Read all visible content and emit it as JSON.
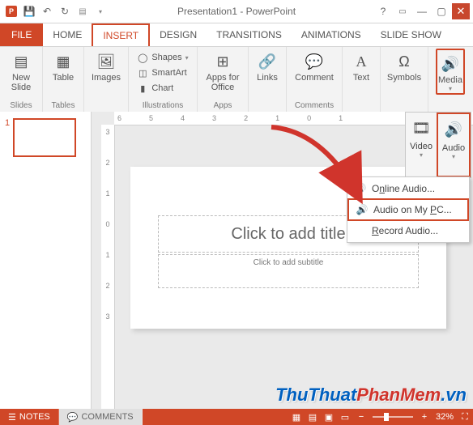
{
  "title": "Presentation1 - PowerPoint",
  "tabs": {
    "file": "FILE",
    "home": "HOME",
    "insert": "INSERT",
    "design": "DESIGN",
    "transitions": "TRANSITIONS",
    "animations": "ANIMATIONS",
    "slideshow": "SLIDE SHOW"
  },
  "ribbon": {
    "new_slide": "New Slide",
    "table": "Table",
    "images": "Images",
    "shapes": "Shapes",
    "smartart": "SmartArt",
    "chart": "Chart",
    "apps": "Apps for Office",
    "links": "Links",
    "comment": "Comment",
    "text": "Text",
    "symbols": "Symbols",
    "media": "Media",
    "grp_slides": "Slides",
    "grp_tables": "Tables",
    "grp_illus": "Illustrations",
    "grp_apps": "Apps",
    "grp_comments": "Comments"
  },
  "media_panel": {
    "video": "Video",
    "audio": "Audio"
  },
  "audio_menu": {
    "online": {
      "pre": "O",
      "u": "n",
      "post": "line Audio..."
    },
    "mypc": {
      "pre": "Audio on My ",
      "u": "P",
      "post": "C..."
    },
    "record": {
      "pre": "",
      "u": "R",
      "post": "ecord Audio..."
    }
  },
  "ruler_h": [
    "6",
    "5",
    "4",
    "3",
    "2",
    "1",
    "0",
    "1"
  ],
  "ruler_v": [
    "3",
    "2",
    "1",
    "0",
    "1",
    "2",
    "3"
  ],
  "thumb": {
    "num": "1"
  },
  "slide": {
    "title": "Click to add title",
    "sub": "Click to add subtitle"
  },
  "status": {
    "notes": "NOTES",
    "comments": "COMMENTS",
    "zoom": "32%"
  },
  "watermark": {
    "a": "ThuThuat",
    "b": "PhanMem",
    "c": ".vn"
  }
}
